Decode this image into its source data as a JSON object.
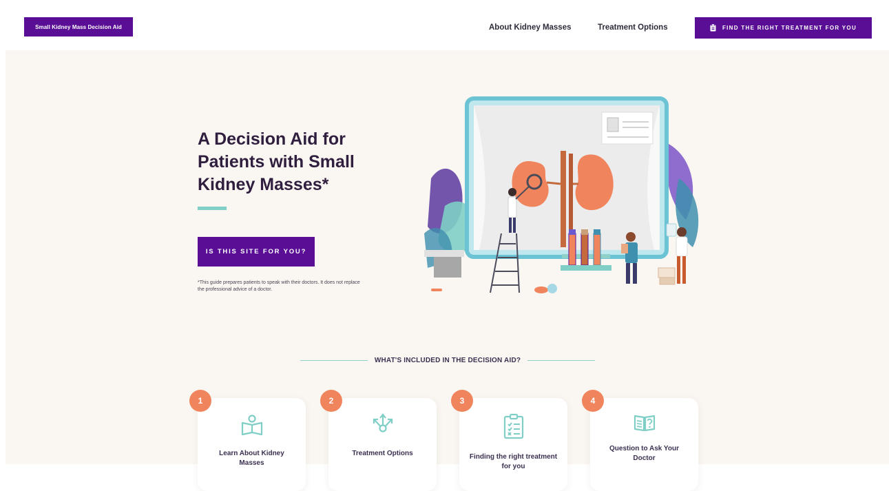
{
  "header": {
    "logo_label": "Small Kidney Mass Decision Aid",
    "nav_about": "About Kidney Masses",
    "nav_treatment": "Treatment Options",
    "cta_label": "FIND THE RIGHT TREATMENT FOR YOU",
    "cta_icon": "clipboard-icon"
  },
  "hero": {
    "title": "A Decision Aid for Patients with Small Kidney Masses*",
    "button_label": "IS THIS SITE FOR YOU?",
    "note": "*This guide prepares patients to speak with their doctors. It does not replace the professional advice of a doctor."
  },
  "section": {
    "title": "WHAT'S INCLUDED IN THE DECISION AID?"
  },
  "cards": [
    {
      "number": "1",
      "label": "Learn About Kidney Masses",
      "icon": "book-person-icon"
    },
    {
      "number": "2",
      "label": "Treatment Options",
      "icon": "branching-arrows-icon"
    },
    {
      "number": "3",
      "label": "Finding the right treatment for you",
      "icon": "checklist-icon"
    },
    {
      "number": "4",
      "label": "Question to Ask Your Doctor",
      "icon": "question-book-icon"
    }
  ],
  "colors": {
    "brand_purple": "#5a0e96",
    "accent_teal": "#7fcfc7",
    "accent_orange": "#f0855d",
    "hero_bg": "#faf6f2",
    "heading_dark": "#2f1e3d"
  }
}
